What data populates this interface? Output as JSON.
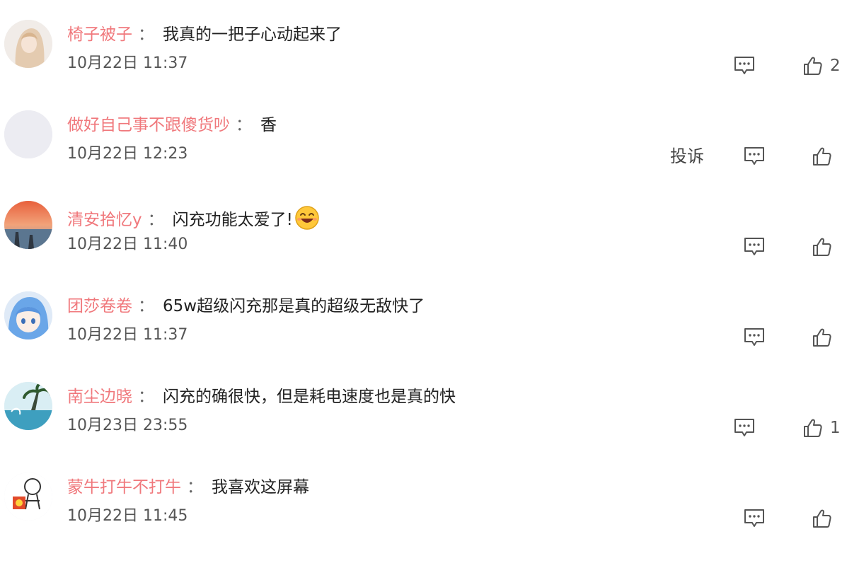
{
  "comments": [
    {
      "user": "椅子被子",
      "separator": "：",
      "text": "我真的一把子心动起来了",
      "time": "10月22日 11:37",
      "likes": "2",
      "reply_icon": "reply-icon",
      "like_icon": "thumbs-up-icon"
    },
    {
      "user": "做好自己事不跟傻货吵",
      "separator": "：",
      "text": "香",
      "time": "10月22日 12:23",
      "likes": "",
      "report_label": "投诉",
      "reply_icon": "reply-icon",
      "like_icon": "thumbs-up-icon"
    },
    {
      "user": "清安拾忆y",
      "separator": "：",
      "text": "闪充功能太爱了!",
      "emoji": "grinning-face-emoji",
      "time": "10月22日 11:40",
      "likes": "",
      "reply_icon": "reply-icon",
      "like_icon": "thumbs-up-icon"
    },
    {
      "user": "团莎卷卷",
      "separator": "：",
      "text": "65w超级闪充那是真的超级无敌快了",
      "time": "10月22日 11:37",
      "likes": "",
      "reply_icon": "reply-icon",
      "like_icon": "thumbs-up-icon"
    },
    {
      "user": "南尘边晓",
      "separator": "：",
      "text": "闪充的确很快，但是耗电速度也是真的快",
      "time": "10月23日 23:55",
      "likes": "1",
      "reply_icon": "reply-icon",
      "like_icon": "thumbs-up-icon"
    },
    {
      "user": "蒙牛打牛不打牛",
      "separator": "：",
      "text": "我喜欢这屏幕",
      "time": "10月22日 11:45",
      "likes": "",
      "reply_icon": "reply-icon",
      "like_icon": "thumbs-up-icon"
    }
  ],
  "colors": {
    "username": "#f0787c",
    "text": "#222222",
    "time": "#555555",
    "icon": "#444444"
  }
}
